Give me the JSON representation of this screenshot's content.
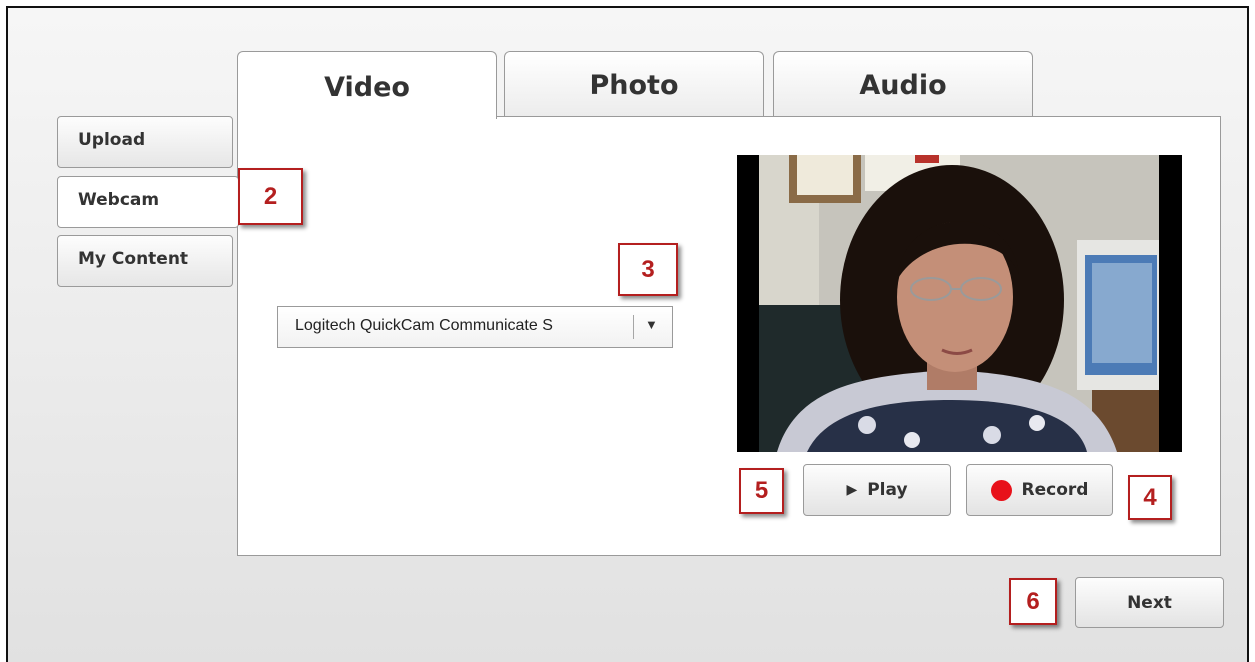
{
  "tabs": [
    {
      "label": "Video",
      "active": true
    },
    {
      "label": "Photo",
      "active": false
    },
    {
      "label": "Audio",
      "active": false
    }
  ],
  "sidebar": {
    "items": [
      {
        "label": "Upload",
        "active": false
      },
      {
        "label": "Webcam",
        "active": true
      },
      {
        "label": "My Content",
        "active": false
      }
    ]
  },
  "camera_select": {
    "selected": "Logitech QuickCam Communicate S",
    "arrow_icon": "dropdown-arrow-icon"
  },
  "video_preview": {
    "content": "webcam-feed-woman-with-glasses"
  },
  "controls": {
    "play_label": "Play",
    "record_label": "Record",
    "play_icon": "play-icon",
    "record_icon": "record-dot-icon"
  },
  "footer": {
    "next_label": "Next"
  },
  "callouts": [
    "2",
    "3",
    "4",
    "5",
    "6"
  ],
  "colors": {
    "callout": "#b41f1f",
    "record_dot": "#e8111a"
  }
}
